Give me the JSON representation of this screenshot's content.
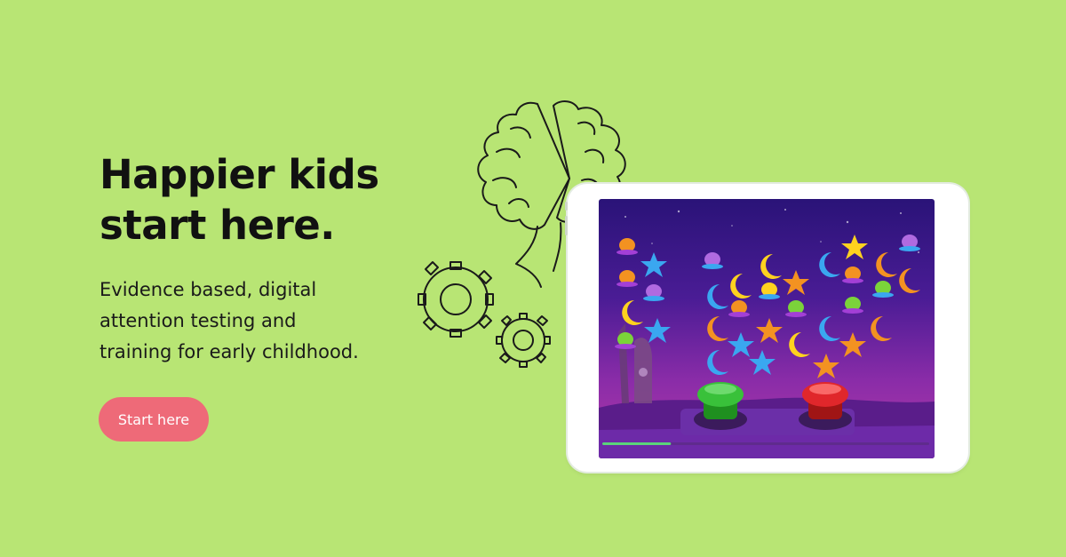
{
  "hero": {
    "title_lines": [
      "Happier kids",
      "start here."
    ],
    "subtitle_lines": [
      "Evidence based, digital",
      "attention testing and",
      "training for early childhood."
    ],
    "cta_label": "Start here"
  },
  "colors": {
    "background": "#b8e574",
    "cta": "#ee6a78",
    "text": "#111111",
    "screen_top": "#2a1378",
    "screen_bottom": "#b23aa6"
  },
  "illustration": {
    "icons": [
      "brain-icon",
      "gear-icon"
    ]
  },
  "game": {
    "buttons": [
      "green-button",
      "red-button"
    ],
    "progress": 0.21
  }
}
